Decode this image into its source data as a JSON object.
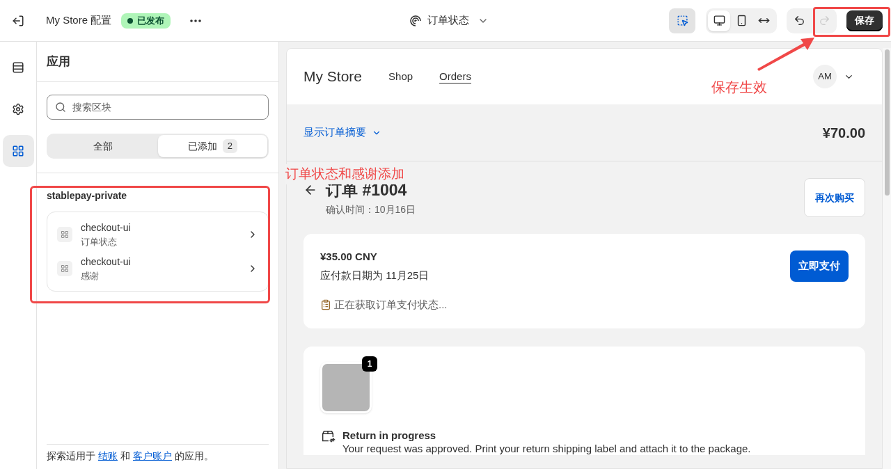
{
  "topbar": {
    "title": "My Store 配置",
    "status": "已发布",
    "template": "订单状态",
    "inspector_selected": true,
    "view_buttons": [
      {
        "kind": "desktop",
        "selected": true
      },
      {
        "kind": "mobile",
        "selected": false
      },
      {
        "kind": "fullwidth",
        "selected": false
      }
    ],
    "redo_disabled": true,
    "save": "保存"
  },
  "rail": [
    {
      "kind": "sections",
      "selected": false
    },
    {
      "kind": "settings",
      "selected": false
    },
    {
      "kind": "apps",
      "selected": true
    }
  ],
  "sidebar": {
    "title": "应用",
    "search": {
      "placeholder": "搜索区块"
    },
    "filter_tabs": [
      {
        "label": "全部",
        "selected": false
      },
      {
        "label": "已添加",
        "count": "2",
        "selected": true
      }
    ],
    "group": {
      "title": "stablepay-private",
      "items": [
        {
          "title": "checkout-ui",
          "subtitle": "订单状态"
        },
        {
          "title": "checkout-ui",
          "subtitle": "感谢"
        }
      ]
    },
    "footer": [
      {
        "kind": "text",
        "text": "探索适用于"
      },
      {
        "kind": "link",
        "text": "结账"
      },
      {
        "kind": "text",
        "text": "和"
      },
      {
        "kind": "link",
        "text": "客户账户"
      },
      {
        "kind": "text",
        "text": "的应用。"
      }
    ]
  },
  "preview": {
    "store_name": "My Store",
    "nav": [
      {
        "label": "Shop",
        "selected": false
      },
      {
        "label": "Orders",
        "selected": true
      }
    ],
    "avatar": "AM",
    "summary_toggle": "显示订单摘要",
    "total": "¥70.00",
    "order_title": "订单 #1004",
    "confirmed": "确认时间：10月16日",
    "buy_again": "再次购买",
    "payment": {
      "amount": "¥35.00 CNY",
      "due": "应付款日期为 11月25日",
      "pay_button": "立即支付",
      "status": "正在获取订单支付状态..."
    },
    "return": {
      "quantity": "1",
      "title": "Return in progress",
      "message": "Your request was approved. Print your return shipping label and attach it to the package."
    }
  },
  "annotations": {
    "save_note": "保存生效",
    "apps_note": "订单状态和感谢添加"
  }
}
